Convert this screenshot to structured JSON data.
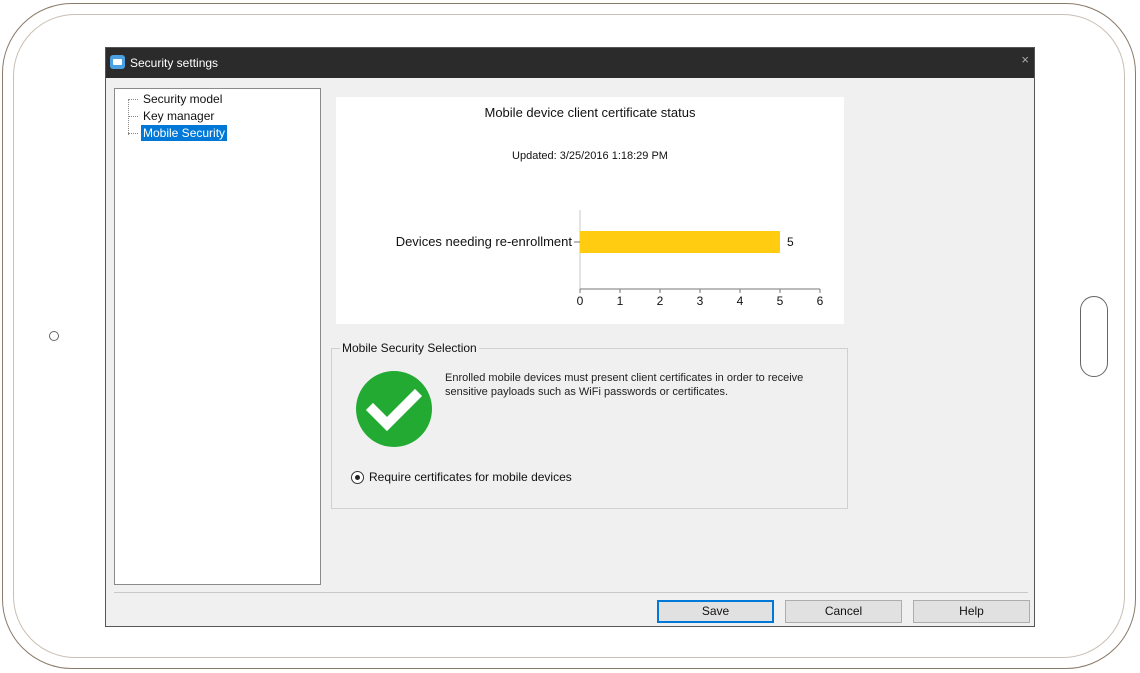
{
  "window": {
    "title": "Security settings"
  },
  "tree": {
    "items": [
      {
        "label": "Security model",
        "selected": false
      },
      {
        "label": "Key manager",
        "selected": false
      },
      {
        "label": "Mobile Security",
        "selected": true
      }
    ]
  },
  "chart_data": {
    "type": "bar",
    "title": "Mobile device client certificate status",
    "subtitle": "Updated: 3/25/2016 1:18:29 PM",
    "orientation": "horizontal",
    "categories": [
      "Devices needing re-enrollment"
    ],
    "values": [
      5
    ],
    "data_labels": [
      "5"
    ],
    "xlim": [
      0,
      6
    ],
    "xticks": [
      "0",
      "1",
      "2",
      "3",
      "4",
      "5",
      "6"
    ],
    "bar_color": "#ffcc11",
    "grid": false
  },
  "security_group": {
    "label": "Mobile Security Selection",
    "icon": "check-circle-icon",
    "icon_color": "#22aa33",
    "description": "Enrolled mobile devices must present client certificates in order to receive sensitive payloads such as WiFi passwords or certificates.",
    "radio_label": "Require certificates for mobile devices",
    "radio_checked": true
  },
  "buttons": {
    "save": "Save",
    "cancel": "Cancel",
    "help": "Help"
  },
  "close_glyph": "×"
}
